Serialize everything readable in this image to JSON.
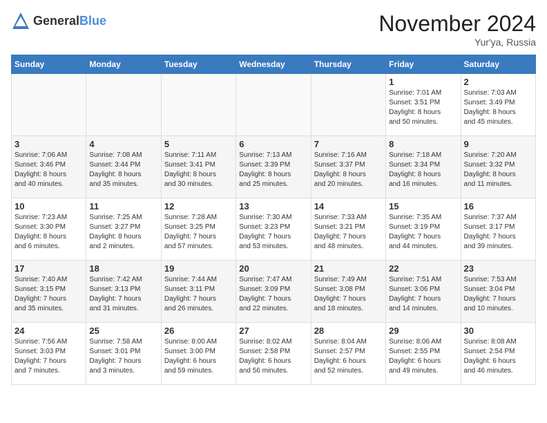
{
  "header": {
    "logo_general": "General",
    "logo_blue": "Blue",
    "month_title": "November 2024",
    "location": "Yur'ya, Russia"
  },
  "days_of_week": [
    "Sunday",
    "Monday",
    "Tuesday",
    "Wednesday",
    "Thursday",
    "Friday",
    "Saturday"
  ],
  "weeks": [
    [
      {
        "day": "",
        "info": ""
      },
      {
        "day": "",
        "info": ""
      },
      {
        "day": "",
        "info": ""
      },
      {
        "day": "",
        "info": ""
      },
      {
        "day": "",
        "info": ""
      },
      {
        "day": "1",
        "info": "Sunrise: 7:01 AM\nSunset: 3:51 PM\nDaylight: 8 hours\nand 50 minutes."
      },
      {
        "day": "2",
        "info": "Sunrise: 7:03 AM\nSunset: 3:49 PM\nDaylight: 8 hours\nand 45 minutes."
      }
    ],
    [
      {
        "day": "3",
        "info": "Sunrise: 7:06 AM\nSunset: 3:46 PM\nDaylight: 8 hours\nand 40 minutes."
      },
      {
        "day": "4",
        "info": "Sunrise: 7:08 AM\nSunset: 3:44 PM\nDaylight: 8 hours\nand 35 minutes."
      },
      {
        "day": "5",
        "info": "Sunrise: 7:11 AM\nSunset: 3:41 PM\nDaylight: 8 hours\nand 30 minutes."
      },
      {
        "day": "6",
        "info": "Sunrise: 7:13 AM\nSunset: 3:39 PM\nDaylight: 8 hours\nand 25 minutes."
      },
      {
        "day": "7",
        "info": "Sunrise: 7:16 AM\nSunset: 3:37 PM\nDaylight: 8 hours\nand 20 minutes."
      },
      {
        "day": "8",
        "info": "Sunrise: 7:18 AM\nSunset: 3:34 PM\nDaylight: 8 hours\nand 16 minutes."
      },
      {
        "day": "9",
        "info": "Sunrise: 7:20 AM\nSunset: 3:32 PM\nDaylight: 8 hours\nand 11 minutes."
      }
    ],
    [
      {
        "day": "10",
        "info": "Sunrise: 7:23 AM\nSunset: 3:30 PM\nDaylight: 8 hours\nand 6 minutes."
      },
      {
        "day": "11",
        "info": "Sunrise: 7:25 AM\nSunset: 3:27 PM\nDaylight: 8 hours\nand 2 minutes."
      },
      {
        "day": "12",
        "info": "Sunrise: 7:28 AM\nSunset: 3:25 PM\nDaylight: 7 hours\nand 57 minutes."
      },
      {
        "day": "13",
        "info": "Sunrise: 7:30 AM\nSunset: 3:23 PM\nDaylight: 7 hours\nand 53 minutes."
      },
      {
        "day": "14",
        "info": "Sunrise: 7:33 AM\nSunset: 3:21 PM\nDaylight: 7 hours\nand 48 minutes."
      },
      {
        "day": "15",
        "info": "Sunrise: 7:35 AM\nSunset: 3:19 PM\nDaylight: 7 hours\nand 44 minutes."
      },
      {
        "day": "16",
        "info": "Sunrise: 7:37 AM\nSunset: 3:17 PM\nDaylight: 7 hours\nand 39 minutes."
      }
    ],
    [
      {
        "day": "17",
        "info": "Sunrise: 7:40 AM\nSunset: 3:15 PM\nDaylight: 7 hours\nand 35 minutes."
      },
      {
        "day": "18",
        "info": "Sunrise: 7:42 AM\nSunset: 3:13 PM\nDaylight: 7 hours\nand 31 minutes."
      },
      {
        "day": "19",
        "info": "Sunrise: 7:44 AM\nSunset: 3:11 PM\nDaylight: 7 hours\nand 26 minutes."
      },
      {
        "day": "20",
        "info": "Sunrise: 7:47 AM\nSunset: 3:09 PM\nDaylight: 7 hours\nand 22 minutes."
      },
      {
        "day": "21",
        "info": "Sunrise: 7:49 AM\nSunset: 3:08 PM\nDaylight: 7 hours\nand 18 minutes."
      },
      {
        "day": "22",
        "info": "Sunrise: 7:51 AM\nSunset: 3:06 PM\nDaylight: 7 hours\nand 14 minutes."
      },
      {
        "day": "23",
        "info": "Sunrise: 7:53 AM\nSunset: 3:04 PM\nDaylight: 7 hours\nand 10 minutes."
      }
    ],
    [
      {
        "day": "24",
        "info": "Sunrise: 7:56 AM\nSunset: 3:03 PM\nDaylight: 7 hours\nand 7 minutes."
      },
      {
        "day": "25",
        "info": "Sunrise: 7:58 AM\nSunset: 3:01 PM\nDaylight: 7 hours\nand 3 minutes."
      },
      {
        "day": "26",
        "info": "Sunrise: 8:00 AM\nSunset: 3:00 PM\nDaylight: 6 hours\nand 59 minutes."
      },
      {
        "day": "27",
        "info": "Sunrise: 8:02 AM\nSunset: 2:58 PM\nDaylight: 6 hours\nand 56 minutes."
      },
      {
        "day": "28",
        "info": "Sunrise: 8:04 AM\nSunset: 2:57 PM\nDaylight: 6 hours\nand 52 minutes."
      },
      {
        "day": "29",
        "info": "Sunrise: 8:06 AM\nSunset: 2:55 PM\nDaylight: 6 hours\nand 49 minutes."
      },
      {
        "day": "30",
        "info": "Sunrise: 8:08 AM\nSunset: 2:54 PM\nDaylight: 6 hours\nand 46 minutes."
      }
    ]
  ]
}
